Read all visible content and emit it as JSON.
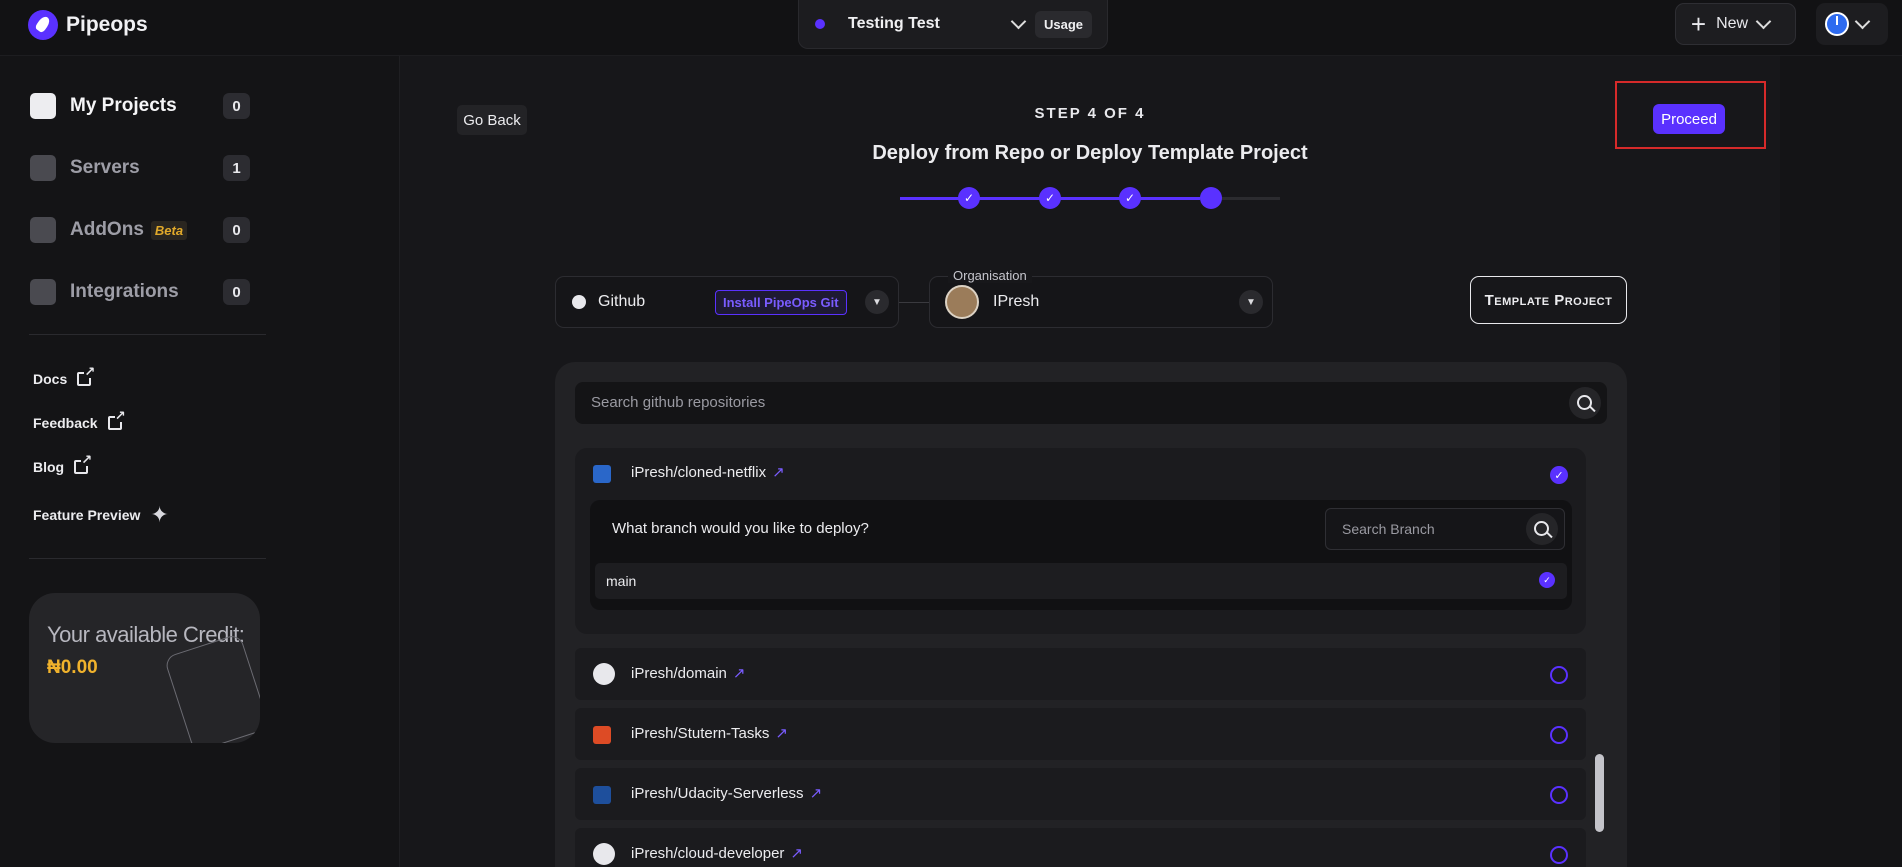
{
  "topbar": {
    "logo": "Pipeops",
    "project": "Testing Test",
    "usage": "Usage",
    "new": "New"
  },
  "sidebar": {
    "items": [
      {
        "label": "My Projects",
        "count": "0"
      },
      {
        "label": "Servers",
        "count": "1"
      },
      {
        "label": "AddOns",
        "badge": "Beta",
        "count": "0"
      },
      {
        "label": "Integrations",
        "count": "0"
      }
    ],
    "links": [
      "Docs",
      "Feedback",
      "Blog",
      "Feature Preview"
    ],
    "credit": {
      "title": "Your available Credit:",
      "value": "₦0.00"
    }
  },
  "main": {
    "go_back": "Go Back",
    "step": "STEP 4 OF 4",
    "title": "Deploy from Repo or Deploy Template Project",
    "proceed": "Proceed",
    "provider": "Github",
    "install": "Install PipeOps Git",
    "org_label": "Organisation",
    "org_name": "IPresh",
    "template": "Template Project",
    "search_placeholder": "Search github repositories",
    "branch_question": "What branch would you like to deploy?",
    "branch_search": "Search Branch",
    "branch": "main",
    "repos": [
      {
        "name": "iPresh/cloned-netflix",
        "icon": "css-icon",
        "selected": true
      },
      {
        "name": "iPresh/domain",
        "icon": "github-icon",
        "selected": false
      },
      {
        "name": "iPresh/Stutern-Tasks",
        "icon": "html-icon",
        "selected": false
      },
      {
        "name": "iPresh/Udacity-Serverless",
        "icon": "typescript-icon",
        "selected": false
      },
      {
        "name": "iPresh/cloud-developer",
        "icon": "github-icon",
        "selected": false
      }
    ]
  },
  "colors": {
    "accent": "#5a31ff",
    "credit": "#f0b22c",
    "highlight": "#d62a2a"
  }
}
